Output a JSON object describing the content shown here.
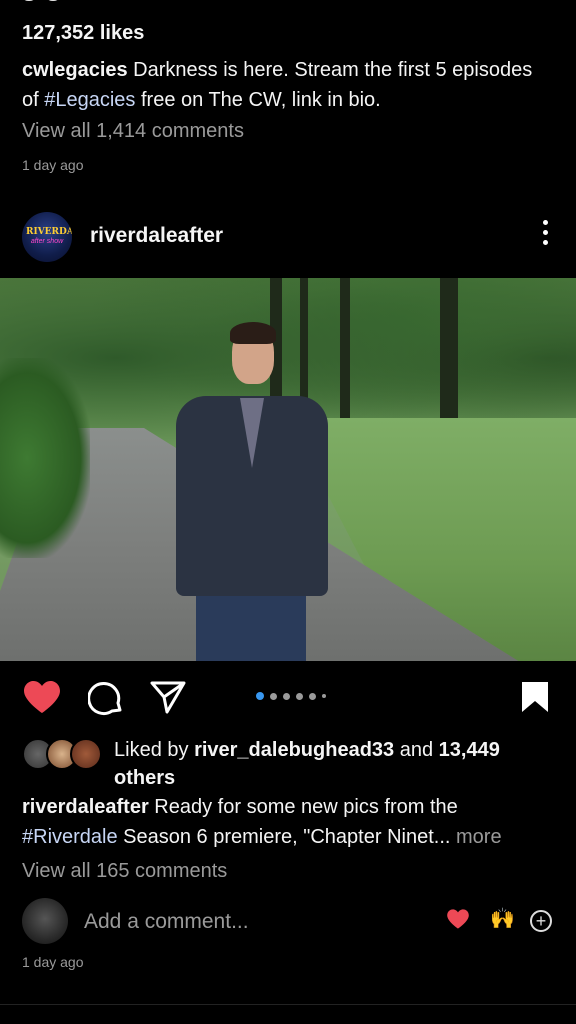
{
  "post1": {
    "likes": "127,352 likes",
    "user": "cwlegacies",
    "caption_before": " Darkness is here. Stream the first 5 episodes of ",
    "hashtag": "#Legacies",
    "caption_after": " free on The CW, link in bio.",
    "view_comments": "View all 1,414 comments",
    "time": "1 day ago"
  },
  "post2": {
    "avatar_logo_line1": "RIVERDALE",
    "avatar_logo_line2": "after show",
    "username": "riverdaleafter",
    "liked_by_prefix": "Liked by ",
    "liked_by_user": "river_dalebughead33",
    "liked_by_mid": " and ",
    "liked_by_count": "13,449 others",
    "caption_user": "riverdaleafter",
    "caption_before": " Ready for some new pics from the ",
    "hashtag": "#Riverdale",
    "caption_after": " Season 6 premiere, \"Chapter Ninet...",
    "more": " more",
    "view_comments": "View all 165 comments",
    "add_comment_placeholder": "Add a comment...",
    "emoji_raise": "🙌",
    "time": "1 day ago"
  },
  "carousel": {
    "count": 6,
    "active_index": 0
  },
  "colors": {
    "like_red": "#ed4956",
    "accent_blue": "#3897f0",
    "hashtag": "#c7d6f5"
  }
}
